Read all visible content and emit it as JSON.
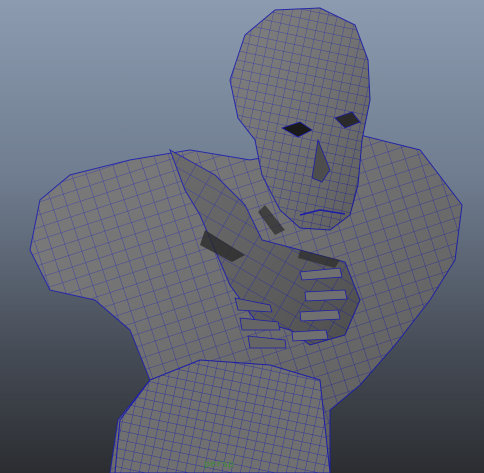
{
  "viewport": {
    "camera_label": "persp",
    "label_color": "#3f8a3a",
    "wire_color": "#1c1ea8",
    "shade_color": "#6e6e6e"
  },
  "scene": {
    "object": "polygon-mesh-bust"
  }
}
